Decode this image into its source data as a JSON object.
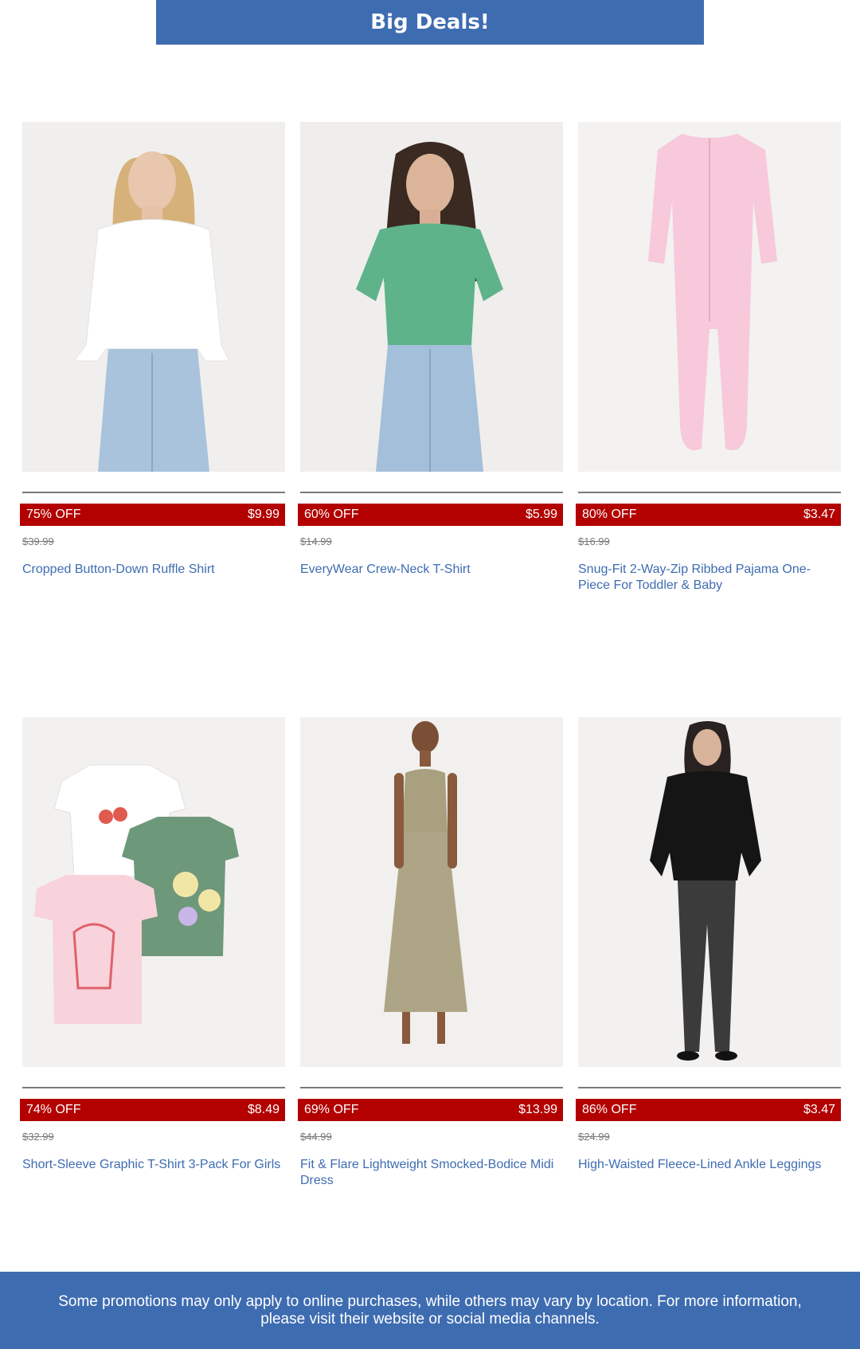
{
  "banner": {
    "title": "Big Deals!"
  },
  "products": [
    {
      "discount": "75% OFF",
      "price": "$9.99",
      "original_price": "$39.99",
      "name": "Cropped Button-Down Ruffle Shirt"
    },
    {
      "discount": "60% OFF",
      "price": "$5.99",
      "original_price": "$14.99",
      "name": "EveryWear Crew-Neck T-Shirt"
    },
    {
      "discount": "80% OFF",
      "price": "$3.47",
      "original_price": "$16.99",
      "name": "Snug-Fit 2-Way-Zip Ribbed Pajama One-Piece For Toddler & Baby"
    },
    {
      "discount": "74% OFF",
      "price": "$8.49",
      "original_price": "$32.99",
      "name": "Short-Sleeve Graphic T-Shirt 3-Pack For Girls"
    },
    {
      "discount": "69% OFF",
      "price": "$13.99",
      "original_price": "$44.99",
      "name": "Fit & Flare Lightweight Smocked-Bodice Midi Dress"
    },
    {
      "discount": "86% OFF",
      "price": "$3.47",
      "original_price": "$24.99",
      "name": "High-Waisted Fleece-Lined Ankle Leggings"
    }
  ],
  "footer": {
    "text": "Some promotions may only apply to online purchases, while others may vary by location. For more information, please visit their website or social media channels."
  },
  "colors": {
    "brand_blue": "#3e6cb1",
    "deal_red": "#b30000"
  }
}
